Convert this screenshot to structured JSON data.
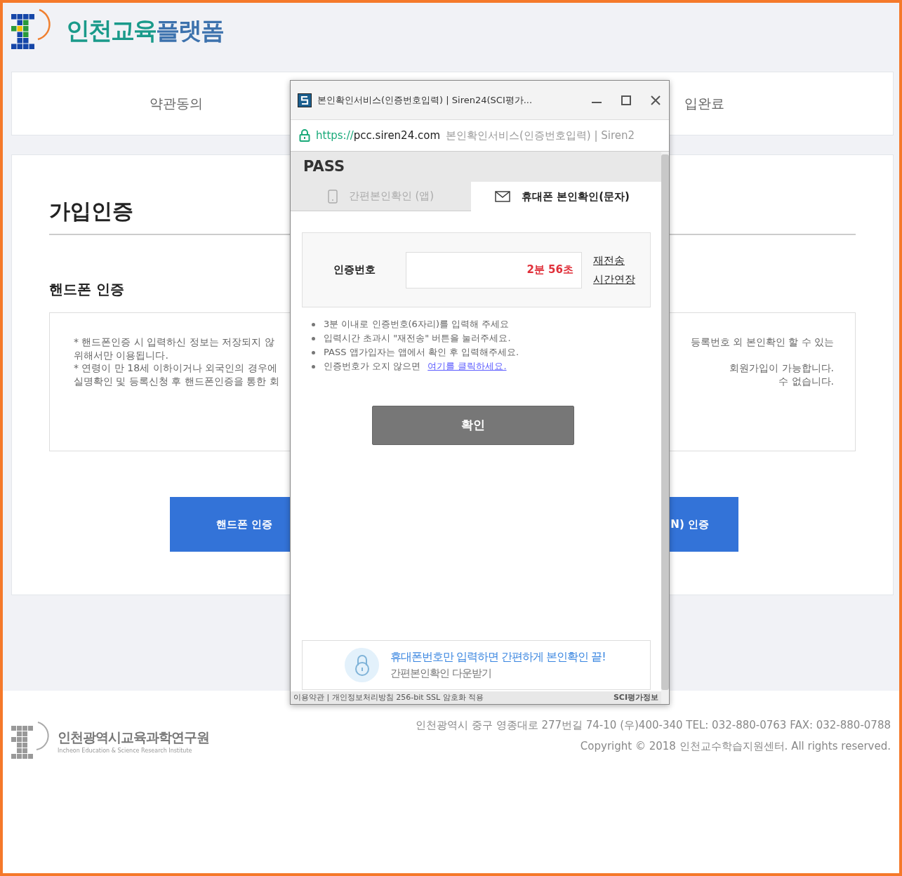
{
  "header": {
    "logo_title_part_1": "인천교육",
    "logo_title_part_2": "플랫폼"
  },
  "steps": {
    "first": "약관동의",
    "last": "입완료"
  },
  "main": {
    "title": "가입인증",
    "section_title": "핸드폰 인증",
    "notice_rows": [
      {
        "left": "* 핸드폰인증 시 입력하신 정보는 저장되지 않",
        "right": "등록번호 외 본인확인 할 수 있는"
      },
      {
        "left": "위해서만 이용됩니다."
      },
      {
        "left": "* 연령이 만 18세 이하이거나 외국인의 경우에",
        "right": "회원가입이 가능합니다."
      },
      {
        "left": "실명확인 및 등록신청 후 핸드폰인증을 통한 회",
        "right": "수 없습니다."
      }
    ],
    "buttons": [
      "핸드폰 인증",
      "N) 인증"
    ]
  },
  "footer": {
    "org_name": "인천광역시교육과학연구원",
    "org_subtitle": "Incheon Education & Science Research Institute",
    "address": "인천광역시 중구 영종대로 277번길 74-10 (우)400-340 TEL: 032-880-0763 FAX: 032-880-0788",
    "copyright": "Copyright © 2018 인천교수학습지원센터. All rights reserved."
  },
  "popup": {
    "window_title": "본인확인서비스(인증번호입력) | Siren24(SCI평가...",
    "url_scheme": "https://",
    "url_host": "pcc.siren24.com",
    "url_page_title": "본인확인서비스(인증번호입력) | Siren2",
    "brand": "PASS",
    "tabs": [
      {
        "label": "간편본인확인 (앱)",
        "kind": "phone",
        "selected": false
      },
      {
        "label": "휴대폰 본인확인(문자)",
        "kind": "envelope",
        "selected": true
      }
    ],
    "code_label": "인증번호",
    "timer": "2분 56초",
    "resend_link": "재전송",
    "extend_link": "시간연장",
    "notes": [
      {
        "text": "3분 이내로 인증번호(6자리)를 입력해 주세요"
      },
      {
        "text": "입력시간 초과시 \"재전송\" 버튼을 눌러주세요."
      },
      {
        "text": "PASS 앱가입자는 앱에서 확인 후 입력해주세요."
      },
      {
        "text": "인증번호가 오지 않으면",
        "link": "여기를 클릭하세요."
      }
    ],
    "confirm_button": "확인",
    "banner_headline": "휴대폰번호만 입력하면 간편하게 본인확인 끝!",
    "banner_subtext": "간편본인확인 다운받기",
    "footer_links": "이용약관 | 개인정보처리방침 256-bit SSL 암호화 적용",
    "footer_brand": "SCI평가정보"
  }
}
